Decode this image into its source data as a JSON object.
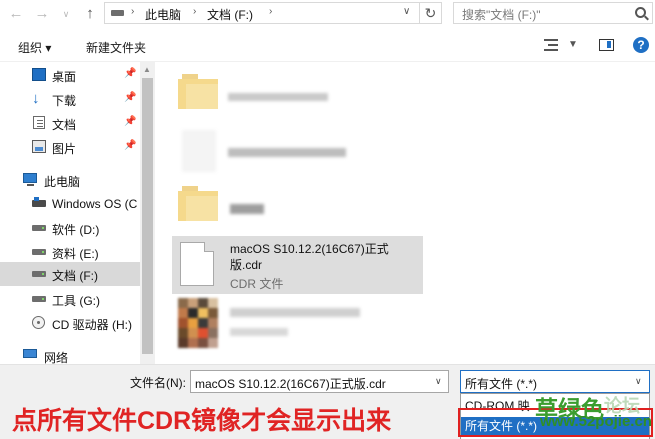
{
  "address_bar": {
    "back_icon": "arrow-left-icon",
    "forward_icon": "arrow-right-icon",
    "up_icon": "arrow-up-icon",
    "path": [
      "此电脑",
      "文档 (F:)"
    ],
    "search_placeholder": "搜索\"文档 (F:)\""
  },
  "toolbar": {
    "organize": "组织 ▾",
    "new_folder": "新建文件夹"
  },
  "nav": {
    "items": [
      {
        "label": "桌面",
        "icon": "desktop-icon",
        "pinned": true
      },
      {
        "label": "下载",
        "icon": "download-icon",
        "pinned": true
      },
      {
        "label": "文档",
        "icon": "document-icon",
        "pinned": true
      },
      {
        "label": "图片",
        "icon": "picture-icon",
        "pinned": true
      },
      {
        "label": "此电脑",
        "icon": "computer-icon"
      },
      {
        "label": "Windows OS (C",
        "icon": "windows-drive-icon"
      },
      {
        "label": "软件 (D:)",
        "icon": "drive-icon"
      },
      {
        "label": "资料 (E:)",
        "icon": "drive-icon"
      },
      {
        "label": "文档 (F:)",
        "icon": "drive-icon",
        "selected": true
      },
      {
        "label": "工具 (G:)",
        "icon": "drive-icon"
      },
      {
        "label": "CD 驱动器 (H:)",
        "icon": "cd-drive-icon"
      },
      {
        "label": "网络",
        "icon": "network-icon"
      }
    ]
  },
  "files": {
    "selected": {
      "name": "macOS S10.12.2(16C67)正式版.cdr",
      "type": "CDR 文件"
    }
  },
  "bottom": {
    "filename_label": "文件名(N):",
    "filename_value": "macOS S10.12.2(16C67)正式版.cdr",
    "filetype_value": "所有文件 (*.*)",
    "dropdown_options": [
      "CD-ROM 映",
      "所有文件 (*.*)"
    ]
  },
  "annotation": "点所有文件CDR镜像才会显示出来",
  "watermark": {
    "text": "草绿色",
    "faded": "论坛",
    "url": "www.52pojie.cn"
  },
  "colors": {
    "accent": "#1f6fc4",
    "annotation": "#e02424",
    "watermark": "#3b9d2f"
  }
}
